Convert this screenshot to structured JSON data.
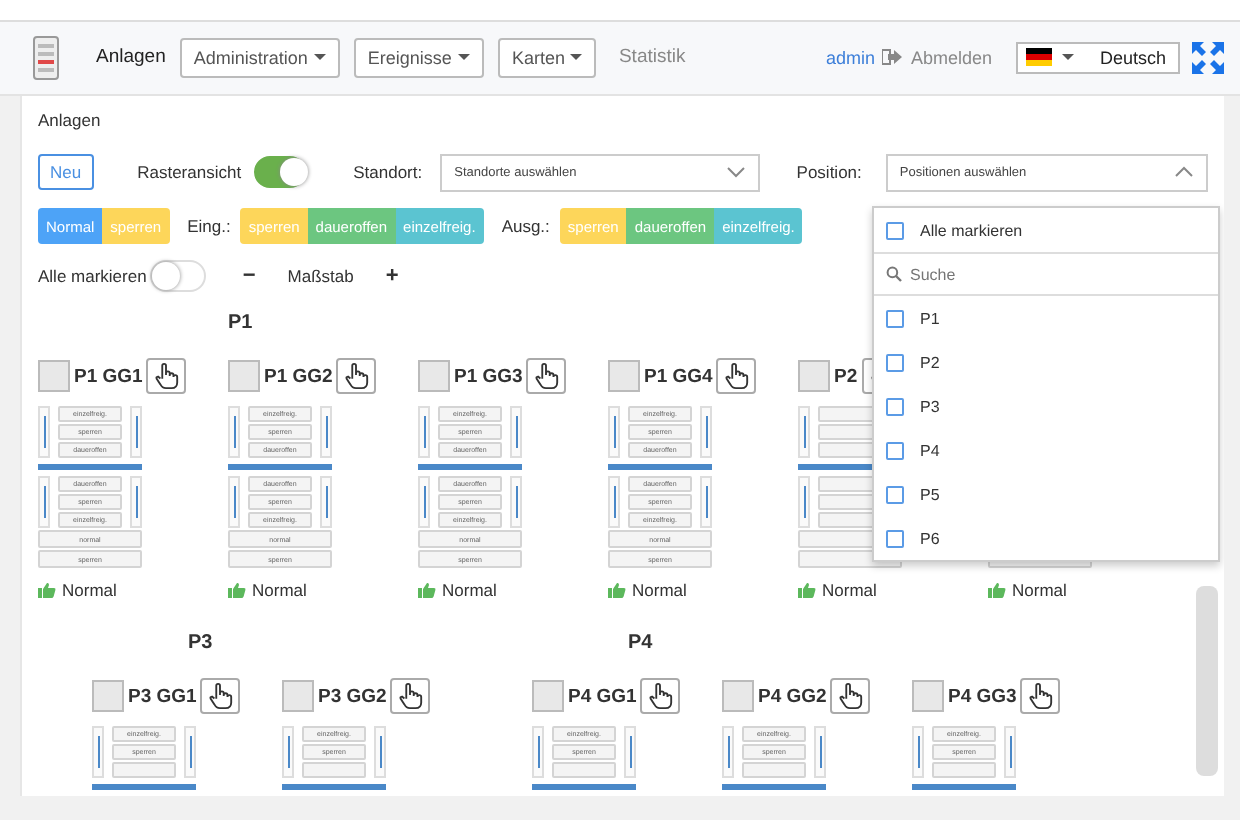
{
  "header": {
    "nav": [
      {
        "label": "Anlagen",
        "kind": "link"
      },
      {
        "label": "Administration",
        "kind": "dropdown"
      },
      {
        "label": "Ereignisse",
        "kind": "dropdown"
      },
      {
        "label": "Karten",
        "kind": "dropdown"
      },
      {
        "label": "Statistik",
        "kind": "muted"
      }
    ],
    "user": "admin",
    "logout": "Abmelden",
    "language": "Deutsch"
  },
  "page_title": "Anlagen",
  "toolbar": {
    "new_button": "Neu",
    "grid_view": {
      "label": "Rasteransicht",
      "on": true
    },
    "location": {
      "label": "Standort:",
      "placeholder": "Standorte auswählen"
    },
    "position": {
      "label": "Position:",
      "placeholder": "Positionen auswählen",
      "expanded": true
    }
  },
  "mode_groups": [
    {
      "buttons": [
        {
          "label": "Normal",
          "color": "#4da3f7"
        },
        {
          "label": "sperren",
          "color": "#fdd65a"
        }
      ]
    },
    {
      "label": "Eing.:",
      "buttons": [
        {
          "label": "sperren",
          "color": "#fdd65a"
        },
        {
          "label": "daueroffen",
          "color": "#6cc680"
        },
        {
          "label": "einzelfreig.",
          "color": "#5bc4d1"
        }
      ]
    },
    {
      "label": "Ausg.:",
      "buttons": [
        {
          "label": "sperren",
          "color": "#fdd65a"
        },
        {
          "label": "daueroffen",
          "color": "#6cc680"
        },
        {
          "label": "einzelfreig.",
          "color": "#5bc4d1"
        }
      ]
    }
  ],
  "select_all": {
    "label": "Alle markieren",
    "on": false
  },
  "scale": {
    "minus": "−",
    "label": "Maßstab",
    "plus": "+"
  },
  "position_dropdown": {
    "select_all": {
      "label": "Alle markieren",
      "checked": false
    },
    "search": {
      "placeholder": "Suche"
    },
    "options": [
      {
        "label": "P1",
        "checked": false
      },
      {
        "label": "P2",
        "checked": false
      },
      {
        "label": "P3",
        "checked": false
      },
      {
        "label": "P4",
        "checked": false
      },
      {
        "label": "P5",
        "checked": false
      },
      {
        "label": "P6",
        "checked": false
      }
    ]
  },
  "group_rows": [
    [
      {
        "title": "P1",
        "cards": [
          {
            "title": "P1 GG1",
            "upper": [
              "einzelfreig.",
              "sperren",
              "daueroffen"
            ],
            "lower": [
              "daueroffen",
              "sperren",
              "einzelfreig."
            ],
            "footer": [
              "normal",
              "sperren"
            ],
            "status": "Normal"
          },
          {
            "title": "P1 GG2",
            "upper": [
              "einzelfreig.",
              "sperren",
              "daueroffen"
            ],
            "lower": [
              "daueroffen",
              "sperren",
              "einzelfreig."
            ],
            "footer": [
              "normal",
              "sperren"
            ],
            "status": "Normal"
          },
          {
            "title": "P1 GG3",
            "upper": [
              "einzelfreig.",
              "sperren",
              "daueroffen"
            ],
            "lower": [
              "daueroffen",
              "sperren",
              "einzelfreig."
            ],
            "footer": [
              "normal",
              "sperren"
            ],
            "status": "Normal"
          },
          {
            "title": "P1 GG4",
            "upper": [
              "einzelfreig.",
              "sperren",
              "daueroffen"
            ],
            "lower": [
              "daueroffen",
              "sperren",
              "einzelfreig."
            ],
            "footer": [
              "normal",
              "sperren"
            ],
            "status": "Normal"
          }
        ]
      },
      {
        "cards": [
          {
            "title": "P2",
            "status": "Normal"
          },
          {
            "status": "Normal"
          }
        ]
      }
    ],
    [
      {
        "title": "P3",
        "cards": [
          {
            "title": "P3 GG1",
            "upper": [
              "einzelfreig.",
              "sperren"
            ]
          },
          {
            "title": "P3 GG2",
            "upper": [
              "einzelfreig.",
              "sperren"
            ]
          }
        ]
      },
      {
        "title": "P4",
        "cards": [
          {
            "title": "P4 GG1",
            "upper": [
              "einzelfreig.",
              "sperren"
            ]
          },
          {
            "title": "P4 GG2",
            "upper": [
              "einzelfreig.",
              "sperren"
            ]
          },
          {
            "title": "P4 GG3",
            "upper": [
              "einzelfreig.",
              "sperren"
            ]
          }
        ]
      }
    ]
  ]
}
